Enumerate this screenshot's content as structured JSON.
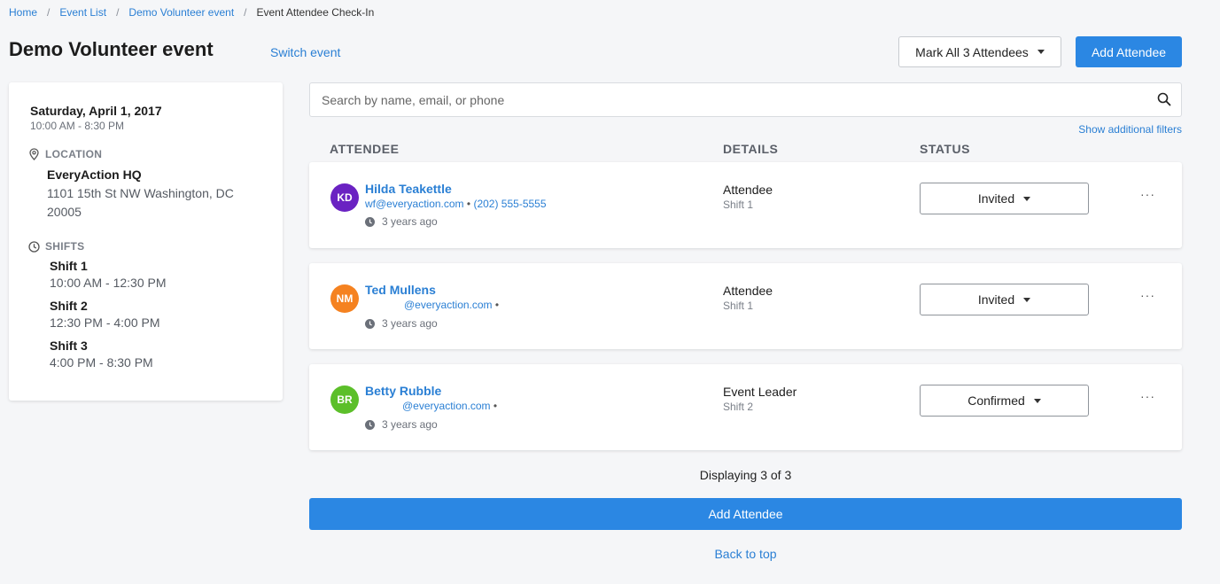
{
  "breadcrumb": [
    {
      "label": "Home"
    },
    {
      "label": "Event List"
    },
    {
      "label": "Demo Volunteer event"
    },
    {
      "label": "Event Attendee Check-In"
    }
  ],
  "header": {
    "title": "Demo Volunteer event",
    "switch_event": "Switch event",
    "mark_all_label": "Mark All 3 Attendees",
    "add_attendee_label": "Add Attendee"
  },
  "sidebar": {
    "date": "Saturday, April 1, 2017",
    "time": "10:00 AM - 8:30 PM",
    "location_heading": "LOCATION",
    "location_name": "EveryAction HQ",
    "location_address": "1101 15th St NW Washington, DC 20005",
    "shifts_heading": "SHIFTS",
    "shifts": [
      {
        "name": "Shift 1",
        "time": "10:00 AM - 12:30 PM"
      },
      {
        "name": "Shift 2",
        "time": "12:30 PM - 4:00 PM"
      },
      {
        "name": "Shift 3",
        "time": "4:00 PM - 8:30 PM"
      }
    ]
  },
  "search": {
    "placeholder": "Search by name, email, or phone",
    "value": "",
    "show_filters": "Show additional filters"
  },
  "columns": {
    "attendee": "ATTENDEE",
    "details": "DETAILS",
    "status": "STATUS"
  },
  "attendees": [
    {
      "initials": "KD",
      "avatar_color": "#6a22c2",
      "name": "Hilda Teakettle",
      "email": "wf@everyaction.com",
      "separator": "•",
      "phone": "(202) 555-5555",
      "time_ago": "3 years ago",
      "role": "Attendee",
      "shift": "Shift 1",
      "status": "Invited",
      "more": "···"
    },
    {
      "initials": "NM",
      "avatar_color": "#f58220",
      "name": "Ted Mullens",
      "email": "@everyaction.com",
      "separator": "•",
      "phone": "",
      "time_ago": "3 years ago",
      "role": "Attendee",
      "shift": "Shift 1",
      "status": "Invited",
      "more": "···"
    },
    {
      "initials": "BR",
      "avatar_color": "#5cbf2a",
      "name": "Betty Rubble",
      "email": "@everyaction.com",
      "separator": "•",
      "phone": "",
      "time_ago": "3 years ago",
      "role": "Event Leader",
      "shift": "Shift 2",
      "status": "Confirmed",
      "more": "···"
    }
  ],
  "footer": {
    "displaying": "Displaying 3 of 3",
    "add_attendee_label": "Add Attendee",
    "back_to_top": "Back to top"
  },
  "colors": {
    "accent": "#2b87e3",
    "link": "#2a7fd4",
    "background": "#f5f6f8"
  }
}
